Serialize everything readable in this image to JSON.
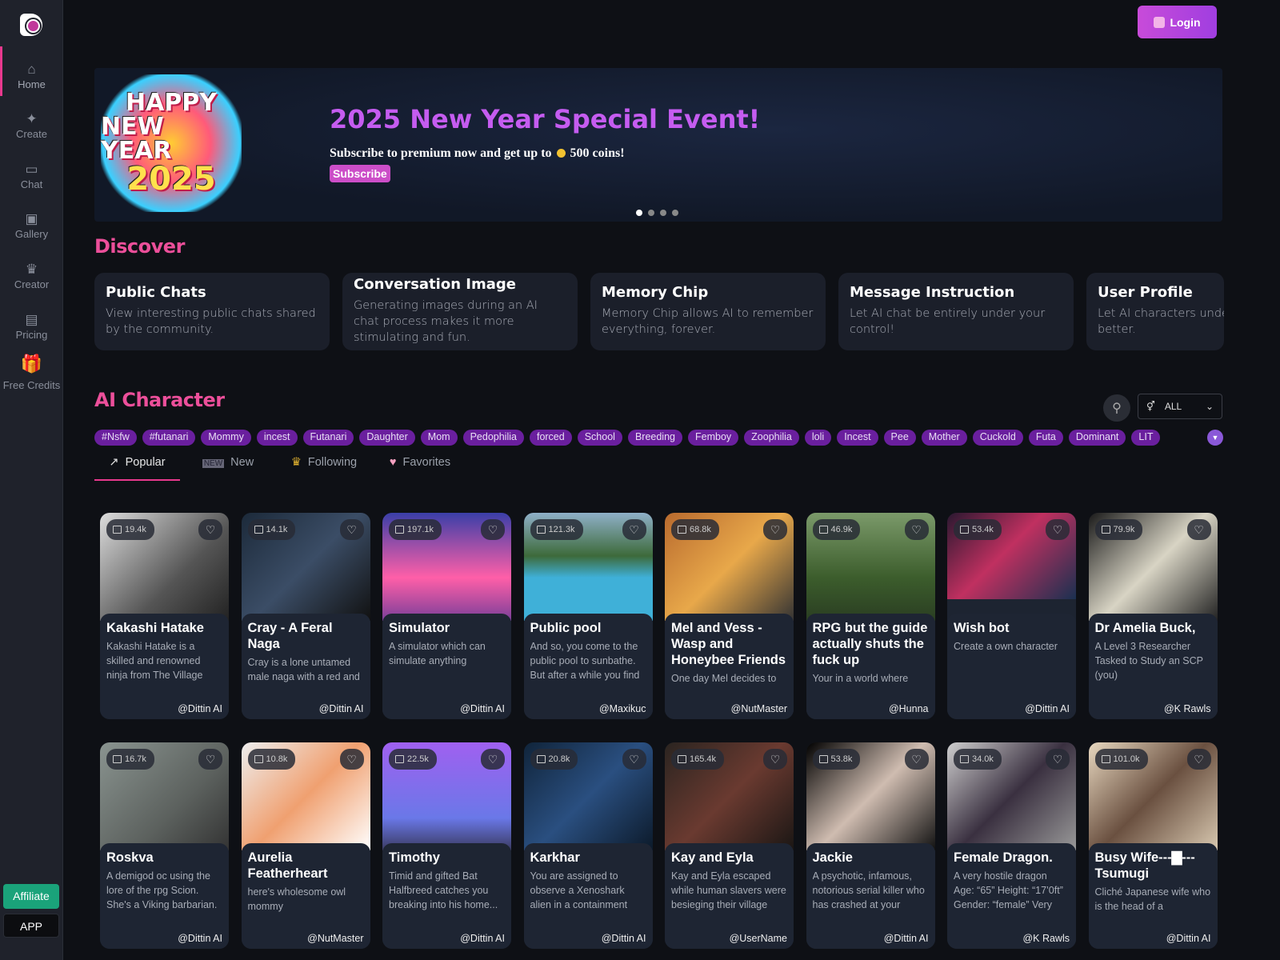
{
  "sidebar": {
    "items": [
      {
        "label": "Home",
        "icon": "home-icon"
      },
      {
        "label": "Create",
        "icon": "sparkle-icon"
      },
      {
        "label": "Chat",
        "icon": "chat-icon"
      },
      {
        "label": "Gallery",
        "icon": "image-icon"
      },
      {
        "label": "Creator",
        "icon": "crown-icon"
      },
      {
        "label": "Pricing",
        "icon": "card-icon"
      },
      {
        "label": "Free Credits",
        "icon": "gift-icon"
      }
    ],
    "affiliate": "Affiliate",
    "app": "APP"
  },
  "header": {
    "login": "Login"
  },
  "banner": {
    "logo_text": [
      "HAPPY",
      "NEW YEAR",
      "2025"
    ],
    "title": "2025 New Year Special Event!",
    "subtitle_pre": "Subscribe to premium now and get up to",
    "subtitle_post": "500 coins!",
    "button": "Subscribe",
    "slides": 4,
    "active_slide": 1
  },
  "discover": {
    "title": "Discover",
    "cards": [
      {
        "title": "Public Chats",
        "desc": "View interesting public chats shared by the community."
      },
      {
        "title": "Conversation Image",
        "desc": "Generating images during an AI chat process makes it more stimulating and fun."
      },
      {
        "title": "Memory Chip",
        "desc": "Memory Chip allows AI to remember everything, forever."
      },
      {
        "title": "Message Instruction",
        "desc": "Let AI chat be entirely under your control!"
      },
      {
        "title": "User Profile",
        "desc": "Let AI characters understand you better."
      }
    ]
  },
  "characters": {
    "title": "AI Character",
    "filter": "ALL",
    "tags": [
      "#Nsfw",
      "#futanari",
      "Mommy",
      "incest",
      "Futanari",
      "Daughter",
      "Mom",
      "Pedophilia",
      "forced",
      "School",
      "Breeding",
      "Femboy",
      "Zoophilia",
      "loli",
      "Incest",
      "Pee",
      "Mother",
      "Cuckold",
      "Futa",
      "Dominant",
      "LIT"
    ],
    "tabs": [
      {
        "label": "Popular",
        "icon": "trend-icon"
      },
      {
        "label": "New",
        "icon": "new-icon"
      },
      {
        "label": "Following",
        "icon": "crown-icon"
      },
      {
        "label": "Favorites",
        "icon": "heart-icon"
      }
    ],
    "cards": [
      {
        "count": "19.4k",
        "name": "Kakashi Hatake",
        "desc": "Kakashi Hatake is a skilled and renowned ninja from The Village",
        "author": "@Dittin AI"
      },
      {
        "count": "14.1k",
        "name": "Cray - A Feral Naga",
        "desc": "Cray is a lone untamed male naga with a red and",
        "author": "@Dittin AI"
      },
      {
        "count": "197.1k",
        "name": "Simulator",
        "desc": "A simulator which can simulate anything",
        "author": "@Dittin AI"
      },
      {
        "count": "121.3k",
        "name": "Public pool",
        "desc": "And so, you come to the public pool to sunbathe. But after a while you find",
        "author": "@Maxikuc"
      },
      {
        "count": "68.8k",
        "name": "Mel and Vess - Wasp and Honeybee Friends",
        "desc": "One day Mel decides to",
        "author": "@NutMaster"
      },
      {
        "count": "46.9k",
        "name": "RPG but the guide actually shuts the fuck up",
        "desc": "Your in a world where",
        "author": "@Hunna"
      },
      {
        "count": "53.4k",
        "name": "Wish bot",
        "desc": "Create a own character",
        "author": "@Dittin AI"
      },
      {
        "count": "79.9k",
        "name": "Dr Amelia Buck,",
        "desc": "A Level 3 Researcher Tasked to Study an SCP (you)",
        "author": "@K Rawls"
      },
      {
        "count": "16.7k",
        "name": "Roskva",
        "desc": "A demigod oc using the lore of the rpg Scion. She's a Viking barbarian.",
        "author": "@Dittin AI"
      },
      {
        "count": "10.8k",
        "name": "Aurelia Featherheart",
        "desc": "here's wholesome owl mommy",
        "author": "@NutMaster"
      },
      {
        "count": "22.5k",
        "name": "Timothy",
        "desc": "Timid and gifted Bat Halfbreed catches you breaking into his home...",
        "author": "@Dittin AI"
      },
      {
        "count": "20.8k",
        "name": "Karkhar",
        "desc": "You are assigned to observe a Xenoshark alien in a containment",
        "author": "@Dittin AI"
      },
      {
        "count": "165.4k",
        "name": "Kay and Eyla",
        "desc": "Kay and Eyla escaped while human slavers were besieging their village",
        "author": "@UserName"
      },
      {
        "count": "53.8k",
        "name": "Jackie",
        "desc": "A psychotic, infamous, notorious serial killer who has crashed at your",
        "author": "@Dittin AI"
      },
      {
        "count": "34.0k",
        "name": "Female Dragon.",
        "desc": "A very hostile dragon Age: “65” Height: “17’0ft” Gender: “female” Very",
        "author": "@K Rawls"
      },
      {
        "count": "101.0k",
        "name": "Busy Wife---▇---Tsumugi",
        "desc": "Cliché Japanese wife who is the head of a",
        "author": "@Dittin AI"
      }
    ]
  },
  "colors": {
    "accent": "#e8398e",
    "tag": "#6a1f9e",
    "login": "#b045dd"
  }
}
